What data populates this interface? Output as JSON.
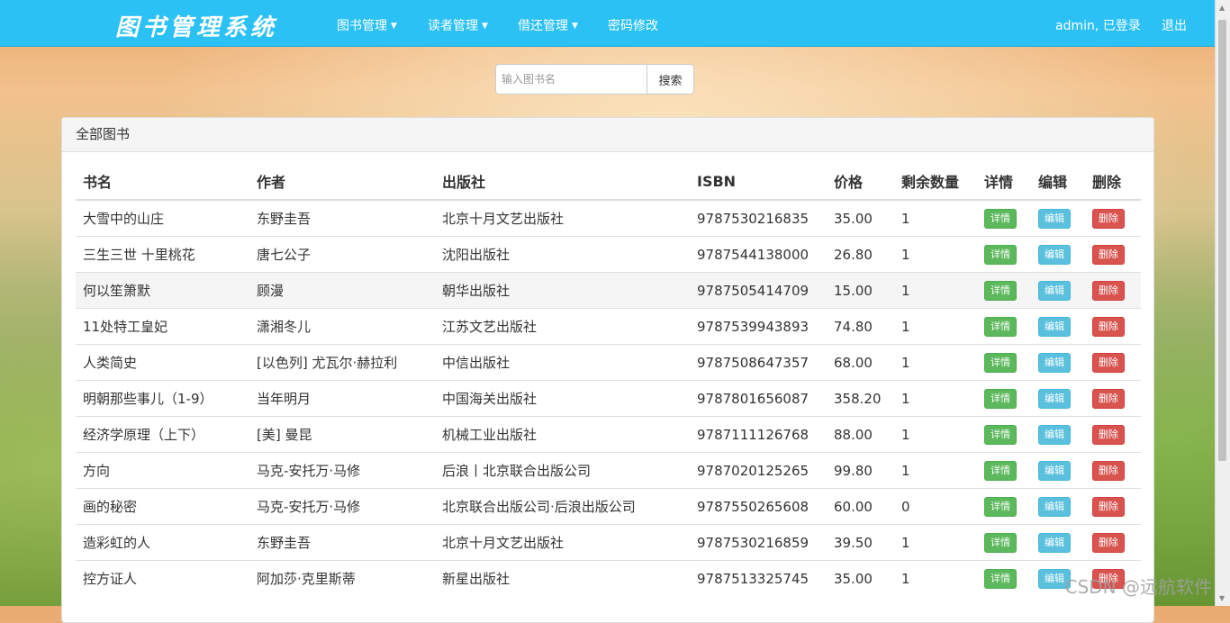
{
  "navbar": {
    "brand": "图书管理系统",
    "menu": [
      {
        "label": "图书管理",
        "dropdown": true
      },
      {
        "label": "读者管理",
        "dropdown": true
      },
      {
        "label": "借还管理",
        "dropdown": true
      },
      {
        "label": "密码修改",
        "dropdown": false
      }
    ],
    "user_status": "admin, 已登录",
    "logout": "退出"
  },
  "search": {
    "placeholder": "输入图书名",
    "button": "搜索"
  },
  "panel": {
    "title": "全部图书"
  },
  "table": {
    "headers": [
      "书名",
      "作者",
      "出版社",
      "ISBN",
      "价格",
      "剩余数量",
      "详情",
      "编辑",
      "删除"
    ],
    "rows": [
      {
        "name": "大雪中的山庄",
        "author": "东野圭吾",
        "publisher": "北京十月文艺出版社",
        "isbn": "9787530216835",
        "price": "35.00",
        "remain": "1"
      },
      {
        "name": "三生三世 十里桃花",
        "author": "唐七公子",
        "publisher": "沈阳出版社",
        "isbn": "9787544138000",
        "price": "26.80",
        "remain": "1"
      },
      {
        "name": "何以笙箫默",
        "author": "顾漫",
        "publisher": "朝华出版社",
        "isbn": "9787505414709",
        "price": "15.00",
        "remain": "1"
      },
      {
        "name": "11处特工皇妃",
        "author": "潇湘冬儿",
        "publisher": "江苏文艺出版社",
        "isbn": "9787539943893",
        "price": "74.80",
        "remain": "1"
      },
      {
        "name": "人类简史",
        "author": "[以色列] 尤瓦尔·赫拉利",
        "publisher": "中信出版社",
        "isbn": "9787508647357",
        "price": "68.00",
        "remain": "1"
      },
      {
        "name": "明朝那些事儿（1-9）",
        "author": "当年明月",
        "publisher": "中国海关出版社",
        "isbn": "9787801656087",
        "price": "358.20",
        "remain": "1"
      },
      {
        "name": "经济学原理（上下）",
        "author": "[美] 曼昆",
        "publisher": "机械工业出版社",
        "isbn": "9787111126768",
        "price": "88.00",
        "remain": "1"
      },
      {
        "name": "方向",
        "author": "马克-安托万·马修",
        "publisher": "后浪丨北京联合出版公司",
        "isbn": "9787020125265",
        "price": "99.80",
        "remain": "1"
      },
      {
        "name": "画的秘密",
        "author": "马克-安托万·马修",
        "publisher": "北京联合出版公司·后浪出版公司",
        "isbn": "9787550265608",
        "price": "60.00",
        "remain": "0"
      },
      {
        "name": "造彩虹的人",
        "author": "东野圭吾",
        "publisher": "北京十月文艺出版社",
        "isbn": "9787530216859",
        "price": "39.50",
        "remain": "1"
      },
      {
        "name": "控方证人",
        "author": "阿加莎·克里斯蒂",
        "publisher": "新星出版社",
        "isbn": "9787513325745",
        "price": "35.00",
        "remain": "1"
      }
    ],
    "btn_detail": "详情",
    "btn_edit": "编辑",
    "btn_delete": "删除"
  },
  "watermark": "CSDN @远航软件",
  "colors": {
    "navbar": "#2bc1f5",
    "detail": "#5cb85c",
    "edit": "#5bc0de",
    "delete": "#d9534f"
  },
  "icons": [
    "caret-down-icon",
    "scroll-up-arrow-icon",
    "scroll-down-arrow-icon"
  ]
}
